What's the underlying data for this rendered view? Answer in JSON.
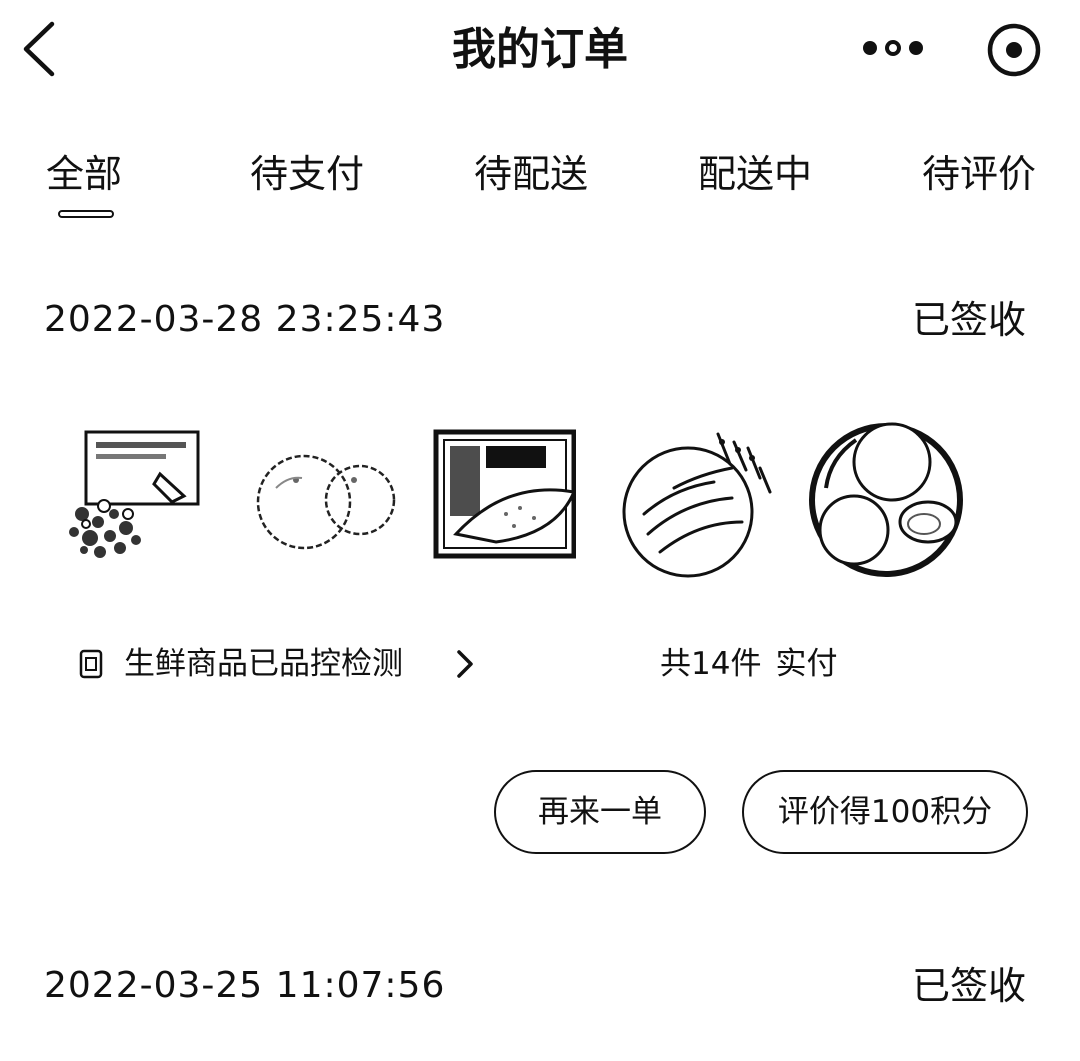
{
  "nav": {
    "title": "我的订单",
    "icons": {
      "back": "chevron-left-icon",
      "more": "more-dots-icon",
      "target": "target-icon"
    }
  },
  "tabs": [
    {
      "label": "全部",
      "active": true
    },
    {
      "label": "待支付",
      "active": false
    },
    {
      "label": "待配送",
      "active": false
    },
    {
      "label": "配送中",
      "active": false
    },
    {
      "label": "待评价",
      "active": false
    }
  ],
  "orders": [
    {
      "time": "2022-03-28 23:25:43",
      "status": "已签收",
      "products": [
        "chopped-vegetables",
        "oranges",
        "packaged-fish",
        "vegetable-plate",
        "fruit-plate"
      ],
      "quality_check": "生鲜商品已品控检测",
      "count_text": "共14件",
      "paid_label": "实付",
      "buttons": {
        "reorder": "再来一单",
        "review": "评价得100积分"
      }
    },
    {
      "time": "2022-03-25 11:07:56",
      "status": "已签收"
    }
  ],
  "colors": {
    "text": "#111111",
    "background": "#ffffff"
  }
}
